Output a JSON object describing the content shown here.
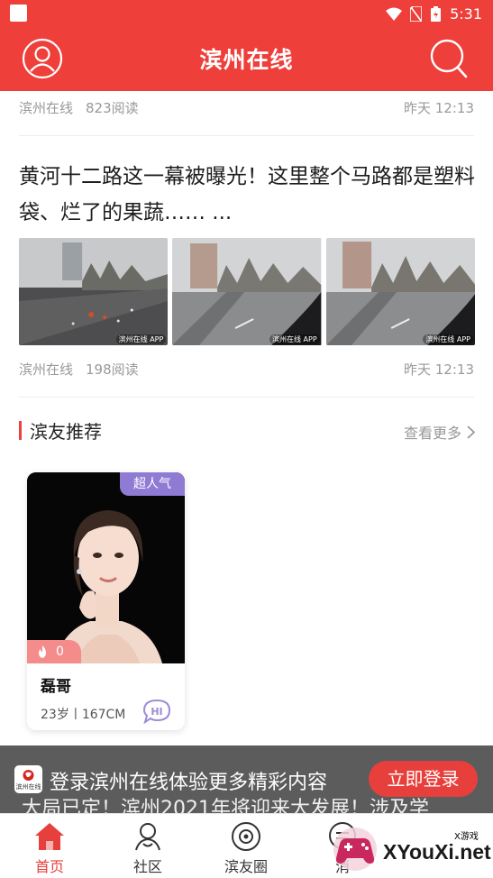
{
  "status_bar": {
    "time": "5:31"
  },
  "app_bar": {
    "title": "滨州在线"
  },
  "feed": {
    "top_item": {
      "source": "滨州在线",
      "reads": "823阅读",
      "time": "昨天 12:13"
    },
    "article": {
      "title": "黄河十二路这一幕被曝光！这里整个马路都是塑料袋、烂了的果蔬…… ...",
      "image_watermark": "滨州在线 APP",
      "source": "滨州在线",
      "reads": "198阅读",
      "time": "昨天 12:13"
    }
  },
  "recommend": {
    "title": "滨友推荐",
    "more_label": "查看更多",
    "card": {
      "badge": "超人气",
      "likes": "0",
      "name": "磊哥",
      "info": "23岁丨167CM",
      "hi_label": "HI"
    }
  },
  "login_banner": {
    "logo_text": "滨州在线",
    "text": "登录滨州在线体验更多精彩内容",
    "button": "立即登录",
    "underlying_text": "大局已定！滨州2021年将迎来大发展！涉及学"
  },
  "tabs": [
    {
      "label": "首页",
      "icon": "home-icon",
      "active": true
    },
    {
      "label": "社区",
      "icon": "community-icon",
      "active": false
    },
    {
      "label": "滨友圈",
      "icon": "circle-icon",
      "active": false
    },
    {
      "label": "消",
      "icon": "message-icon",
      "active": false
    }
  ],
  "watermark": {
    "small": "X游戏",
    "big": "XYouXi.net"
  },
  "colors": {
    "brand_red": "#ee3f3a",
    "badge_purple": "#8f7bd4",
    "likes_pink": "#f48c8c"
  }
}
